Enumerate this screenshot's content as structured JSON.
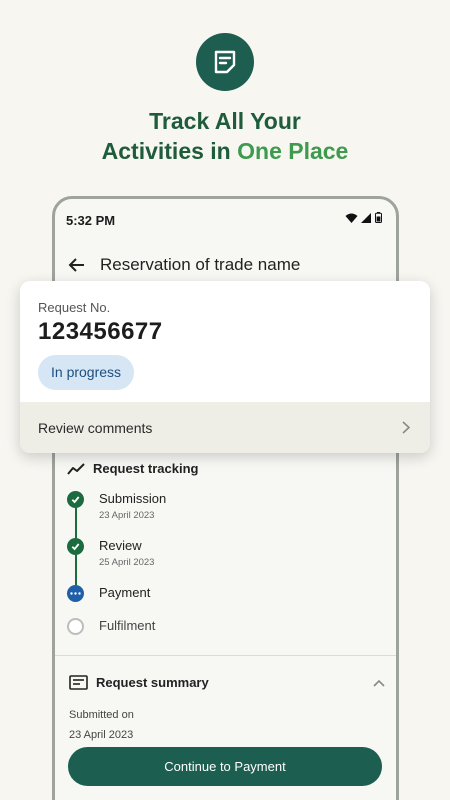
{
  "hero": {
    "line1": "Track All Your",
    "line2_a": "Activities in ",
    "line2_b": "One Place"
  },
  "status_bar": {
    "time": "5:32 PM"
  },
  "app_bar": {
    "title": "Reservation of trade name"
  },
  "request_card": {
    "label": "Request No.",
    "number": "123456677",
    "status": "In progress",
    "review_label": "Review comments"
  },
  "tracking": {
    "title": "Request tracking",
    "steps": [
      {
        "name": "Submission",
        "date": "23 April 2023",
        "state": "done"
      },
      {
        "name": "Review",
        "date": "25 April 2023",
        "state": "done"
      },
      {
        "name": "Payment",
        "date": "",
        "state": "current"
      },
      {
        "name": "Fulfilment",
        "date": "",
        "state": "pending"
      }
    ]
  },
  "summary": {
    "title": "Request summary",
    "submitted_label": "Submitted on",
    "submitted_date": "23 April 2023"
  },
  "cta": {
    "label": "Continue to Payment"
  },
  "colors": {
    "brand": "#1e5e50",
    "success": "#1b6b3e",
    "current": "#1f5ea8",
    "badge_bg": "#d6e6f4"
  }
}
